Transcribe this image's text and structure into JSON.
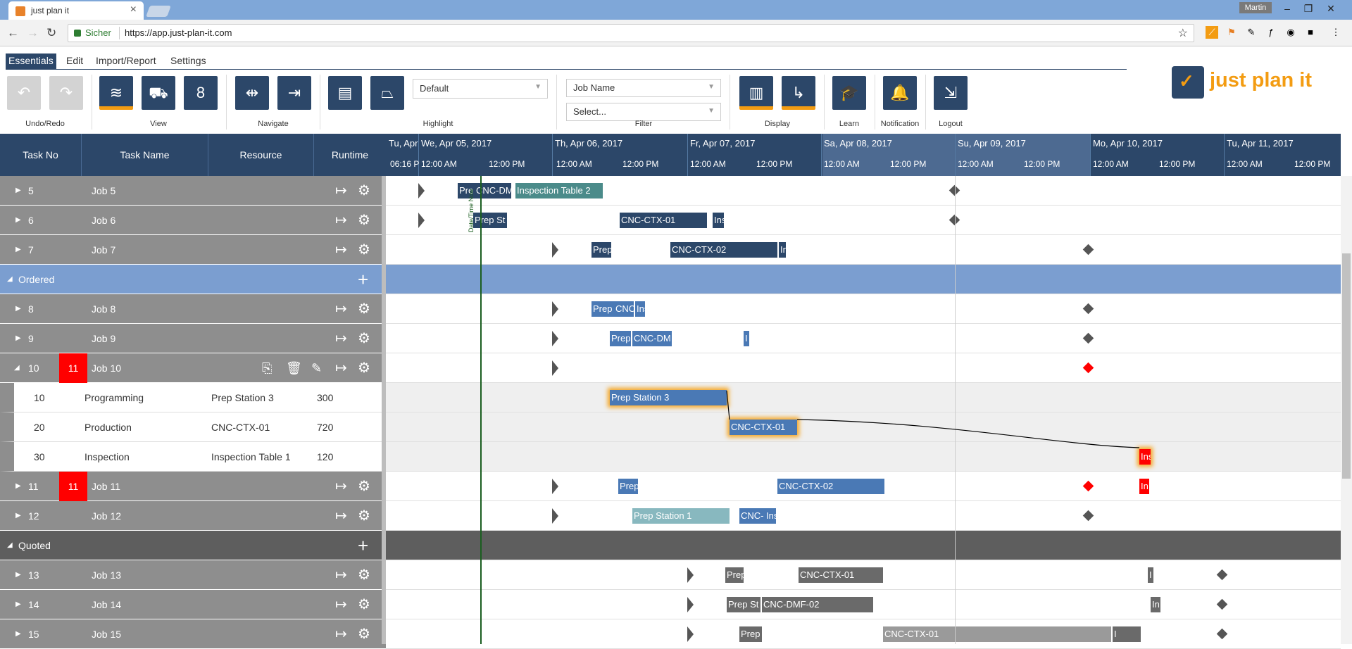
{
  "browser": {
    "tab_title": "just plan it",
    "user": "Martin",
    "secure_label": "Sicher",
    "url": "https://app.just-plan-it.com"
  },
  "ribbon": {
    "tabs": [
      "Essentials",
      "Edit",
      "Import/Report",
      "Settings"
    ],
    "groups": [
      "Undo/Redo",
      "View",
      "Navigate",
      "Highlight",
      "Filter",
      "Display",
      "Learn",
      "Notification",
      "Logout"
    ],
    "highlight_value": "Default",
    "filter_field": "Job Name",
    "filter_value": "Select...",
    "calendar_day": "8",
    "logo_text": "just plan it"
  },
  "grid": {
    "columns": [
      "Task No",
      "Task Name",
      "Resource",
      "Runtime"
    ]
  },
  "timeline": {
    "days": [
      "Tu, Apr",
      "We, Apr 05, 2017",
      "Th, Apr 06, 2017",
      "Fr, Apr 07, 2017",
      "Sa, Apr 08, 2017",
      "Su, Apr 09, 2017",
      "Mo, Apr 10, 2017",
      "Tu, Apr 11, 2017"
    ],
    "hours": [
      "06:16 P",
      "12:00 AM",
      "12:00 PM",
      "12:00 AM",
      "12:00 PM",
      "12:00 AM",
      "12:00 PM",
      "12:00 AM",
      "12:00 PM",
      "12:00 AM",
      "12:00 PM",
      "12:00 AM",
      "12:00 PM",
      "12:00 AM",
      "12:00 PM"
    ]
  },
  "rows": [
    {
      "type": "job",
      "no": "5",
      "name": "Job 5"
    },
    {
      "type": "job",
      "no": "6",
      "name": "Job 6"
    },
    {
      "type": "job",
      "no": "7",
      "name": "Job 7"
    },
    {
      "type": "group",
      "name": "Ordered"
    },
    {
      "type": "job",
      "no": "8",
      "name": "Job 8"
    },
    {
      "type": "job",
      "no": "9",
      "name": "Job 9"
    },
    {
      "type": "job",
      "no": "10",
      "badge": "11",
      "name": "Job 10"
    },
    {
      "type": "sub",
      "no": "10",
      "name": "Programming",
      "resource": "Prep Station 3",
      "runtime": "300"
    },
    {
      "type": "sub",
      "no": "20",
      "name": "Production",
      "resource": "CNC-CTX-01",
      "runtime": "720"
    },
    {
      "type": "sub",
      "no": "30",
      "name": "Inspection",
      "resource": "Inspection Table 1",
      "runtime": "120"
    },
    {
      "type": "job",
      "no": "11",
      "badge": "11",
      "name": "Job 11"
    },
    {
      "type": "job",
      "no": "12",
      "name": "Job 12"
    },
    {
      "type": "group",
      "name": "Quoted"
    },
    {
      "type": "job",
      "no": "13",
      "name": "Job 13"
    },
    {
      "type": "job",
      "no": "14",
      "name": "Job 14"
    },
    {
      "type": "job",
      "no": "15",
      "name": "Job 15"
    }
  ],
  "bars": {
    "r0": [
      "Pre",
      "CNC-DM",
      "Inspection Table 2"
    ],
    "r1": [
      "Prep St",
      "CNC-CTX-01",
      "Ins"
    ],
    "r2": [
      "Prep",
      "CNC-CTX-02",
      "In"
    ],
    "r4": [
      "Prep",
      "CNC-",
      "Ins"
    ],
    "r5": [
      "Prep",
      "CNC-DM",
      "I"
    ],
    "r7": [
      "Prep Station 3"
    ],
    "r8": [
      "CNC-CTX-01"
    ],
    "r9": [
      "Ins"
    ],
    "r10": [
      "Prep",
      "CNC-CTX-02",
      "In"
    ],
    "r11": [
      "Prep Station 1",
      "CNC-",
      "Ins"
    ],
    "r13": [
      "Prep",
      "CNC-CTX-01",
      "I"
    ],
    "r14": [
      "Prep St",
      "CNC-DMF-02",
      "In"
    ],
    "r15": [
      "Prep",
      "CNC-CTX-01",
      "I"
    ]
  },
  "now_label": "Date/Time Now"
}
